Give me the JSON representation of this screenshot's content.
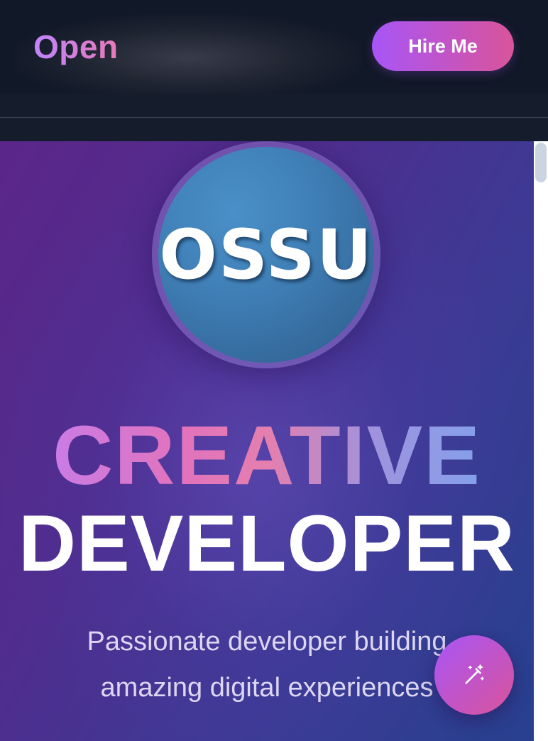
{
  "navbar": {
    "brand": "Open",
    "hire_label": "Hire Me"
  },
  "hero": {
    "logo_text": "OSSU",
    "title_line1": "CREATIVE",
    "title_line2": "DEVELOPER",
    "tagline_line1": "Passionate developer building",
    "tagline_line2": "amazing digital experiences"
  },
  "fab": {
    "icon": "magic-wand-icon"
  },
  "colors": {
    "accent_purple": "#a855f7",
    "accent_pink": "#d9549a",
    "nav_background": "#111827"
  }
}
